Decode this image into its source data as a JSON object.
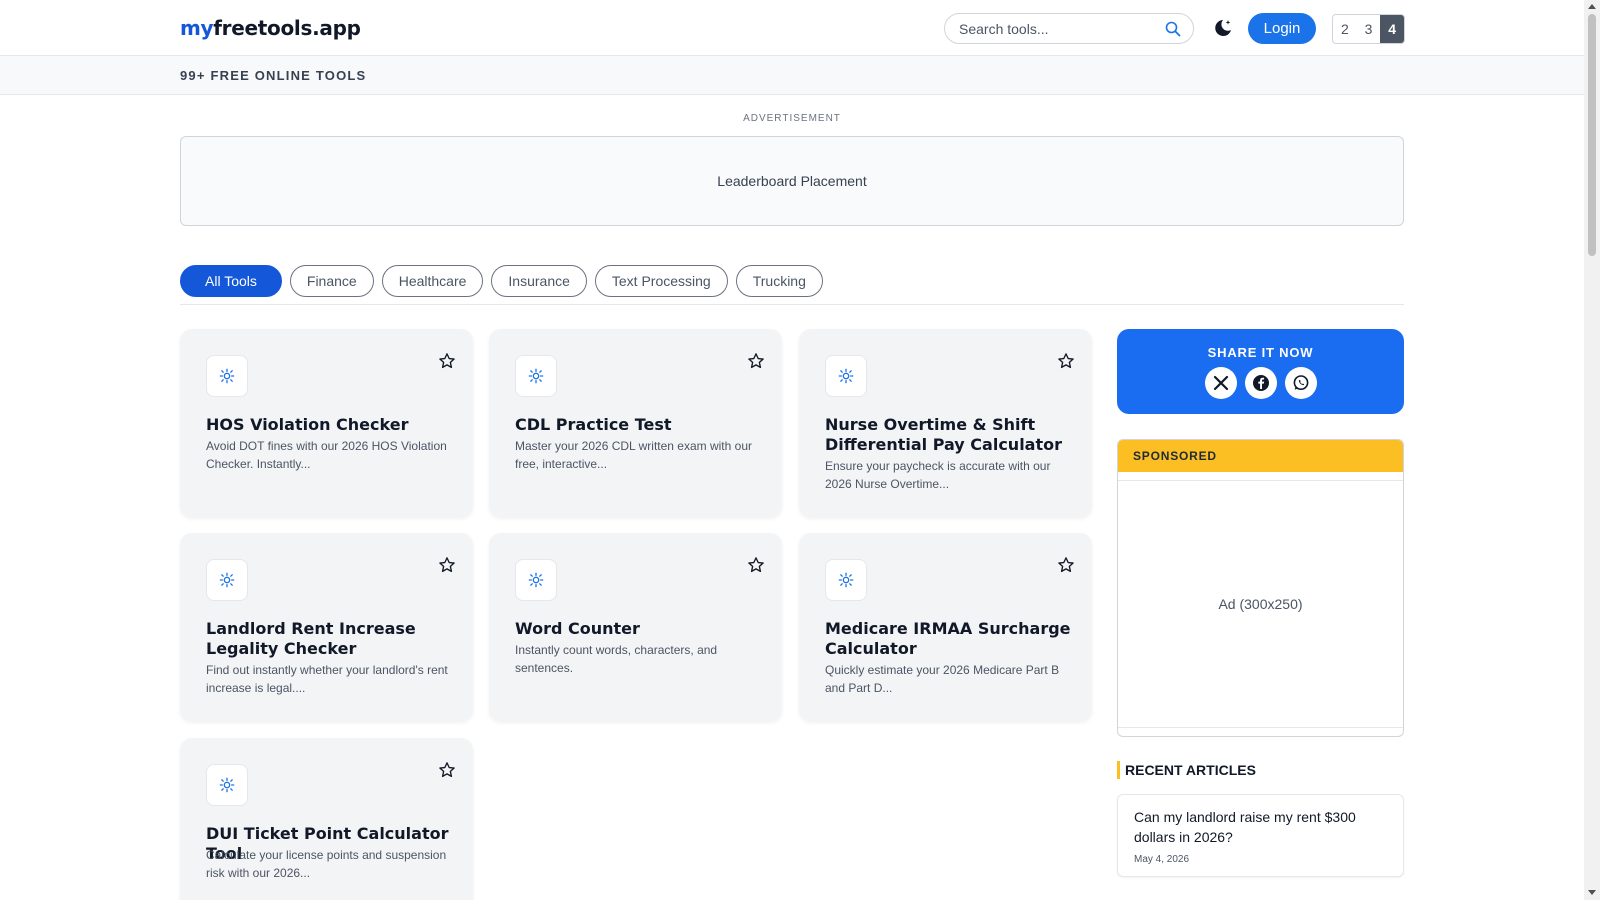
{
  "header": {
    "logo_prefix": "my",
    "logo_rest": "freetools.app",
    "search_placeholder": "Search tools...",
    "login_label": "Login",
    "pages": [
      "2",
      "3",
      "4"
    ],
    "active_page": "4"
  },
  "subbar": {
    "text": "99+ FREE ONLINE TOOLS"
  },
  "ad": {
    "label": "ADVERTISEMENT",
    "leaderboard": "Leaderboard Placement"
  },
  "filters": [
    "All Tools",
    "Finance",
    "Healthcare",
    "Insurance",
    "Text Processing",
    "Trucking"
  ],
  "active_filter": "All Tools",
  "tools": [
    {
      "title": "HOS Violation Checker",
      "desc": "Avoid DOT fines with our 2026 HOS Violation Checker. Instantly..."
    },
    {
      "title": "CDL Practice Test",
      "desc": "Master your 2026 CDL written exam with our free, interactive..."
    },
    {
      "title": "Nurse Overtime & Shift Differential Pay Calculator",
      "desc": "Ensure your paycheck is accurate with our 2026 Nurse Overtime..."
    },
    {
      "title": "Landlord Rent Increase Legality Checker",
      "desc": "Find out instantly whether your landlord's rent increase is legal...."
    },
    {
      "title": "Word Counter",
      "desc": "Instantly count words, characters, and sentences."
    },
    {
      "title": "Medicare IRMAA Surcharge Calculator",
      "desc": "Quickly estimate your 2026 Medicare Part B and Part D..."
    },
    {
      "title": "DUI Ticket Point Calculator Tool",
      "desc": "Calculate your license points and suspension risk with our 2026..."
    }
  ],
  "sidebar": {
    "share_title": "SHARE IT NOW",
    "share_icons": [
      "x-icon",
      "facebook-icon",
      "whatsapp-icon"
    ],
    "sponsored_label": "SPONSORED",
    "sponsored_ad": "Ad (300x250)",
    "recent_title": "RECENT ARTICLES",
    "articles": [
      {
        "title": "Can my landlord raise my rent $300 dollars in 2026?",
        "date": "May 4, 2026"
      }
    ]
  },
  "colors": {
    "brand": "#1458d9",
    "login": "#1a73e8",
    "share": "#1a6cf0",
    "sponsored": "#fbbf24",
    "card_bg": "#f3f4f6"
  }
}
